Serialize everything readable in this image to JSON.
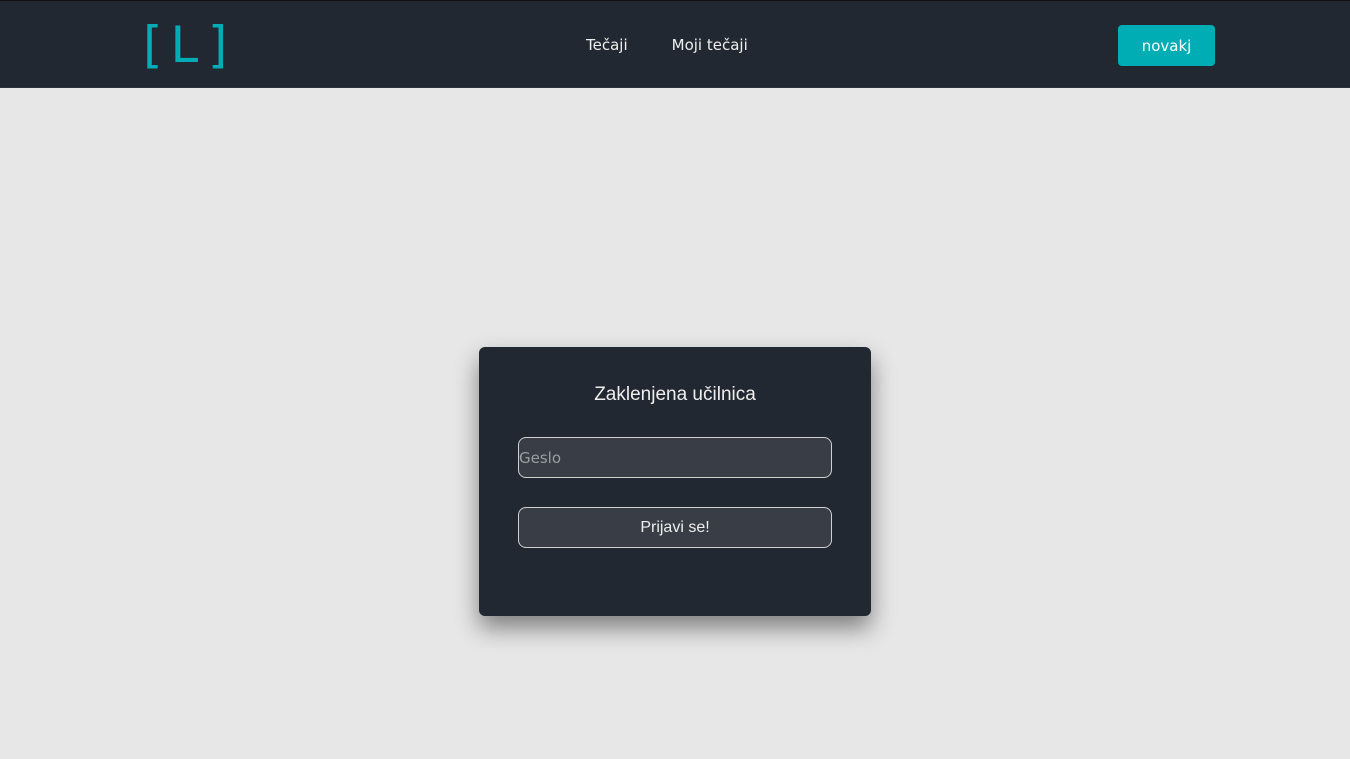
{
  "header": {
    "logo": "[L]",
    "nav": [
      {
        "label": "Tečaji"
      },
      {
        "label": "Moji tečaji"
      }
    ],
    "user_button": "novakj"
  },
  "login_card": {
    "title": "Zaklenjena učilnica",
    "password": {
      "placeholder": "Geslo",
      "value": ""
    },
    "submit_label": "Prijavi se!"
  },
  "colors": {
    "navbar_bg": "#222831",
    "page_bg": "#e7e7e7",
    "accent": "#00adb5",
    "card_bg": "#222831",
    "input_bg": "#393e46"
  }
}
